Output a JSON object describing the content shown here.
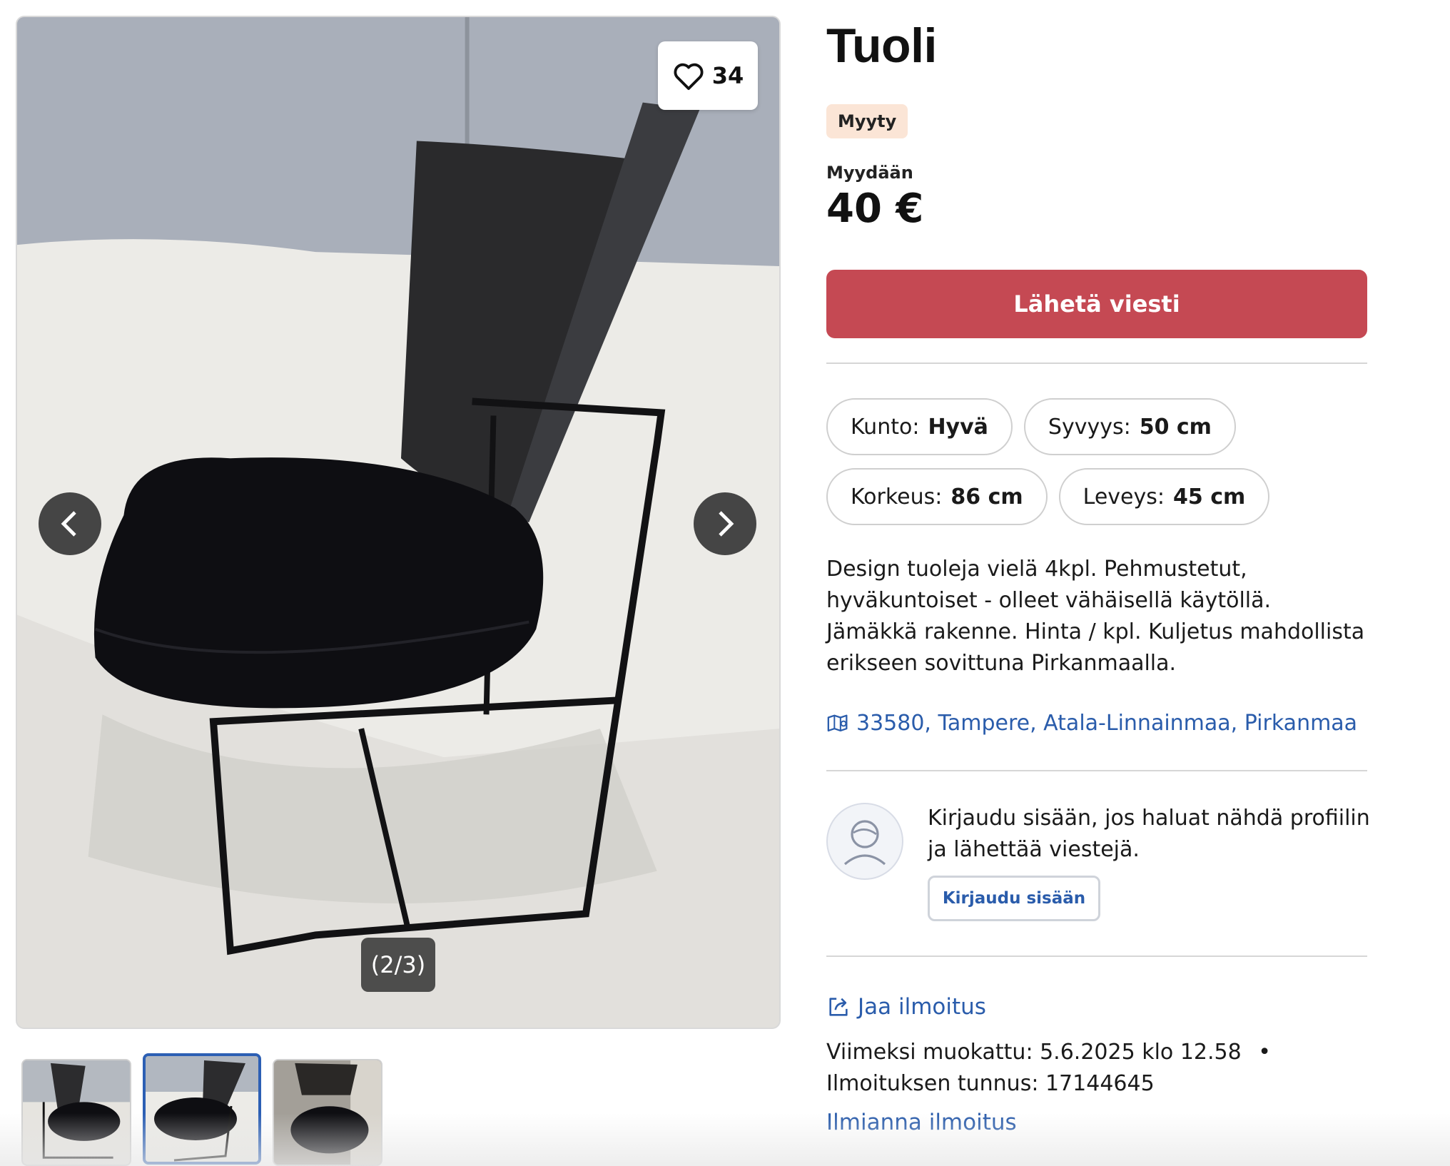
{
  "listing": {
    "title": "Tuoli",
    "status_badge": "Myyty",
    "price_label": "Myydään",
    "price": "40 €",
    "cta_label": "Lähetä viesti",
    "attributes": [
      {
        "key": "Kunto:",
        "value": "Hyvä"
      },
      {
        "key": "Syvyys:",
        "value": "50 cm"
      },
      {
        "key": "Korkeus:",
        "value": "86 cm"
      },
      {
        "key": "Leveys:",
        "value": "45 cm"
      }
    ],
    "description": "Design tuoleja vielä 4kpl. Pehmustetut, hyväkuntoiset - olleet vähäisellä käytöllä. Jämäkkä rakenne. Hinta / kpl. Kuljetus mahdollista erikseen sovittuna Pirkanmaalla.",
    "location": "33580, Tampere, Atala-Linnainmaa, Pirkanmaa"
  },
  "gallery": {
    "favorite_count": "34",
    "counter": "(2/3)",
    "thumbnail_count": 3,
    "active_index": 1
  },
  "seller": {
    "login_prompt": "Kirjaudu sisään, jos haluat nähdä profiilin ja lähettää viestejä.",
    "login_button": "Kirjaudu sisään"
  },
  "footer": {
    "share_label": "Jaa ilmoitus",
    "last_modified": "Viimeksi muokattu: 5.6.2025 klo 12.58",
    "bullet": "•",
    "listing_id": "Ilmoituksen tunnus: 17144645",
    "report_label": "Ilmianna ilmoitus"
  },
  "colors": {
    "cta": "#c54953",
    "link": "#2a5cab",
    "badge_bg": "#fbe5d6",
    "thumb_active_border": "#2c5fb4"
  },
  "icons": [
    "heart-icon",
    "chevron-left-icon",
    "chevron-right-icon",
    "map-icon",
    "user-avatar-icon",
    "share-icon"
  ]
}
